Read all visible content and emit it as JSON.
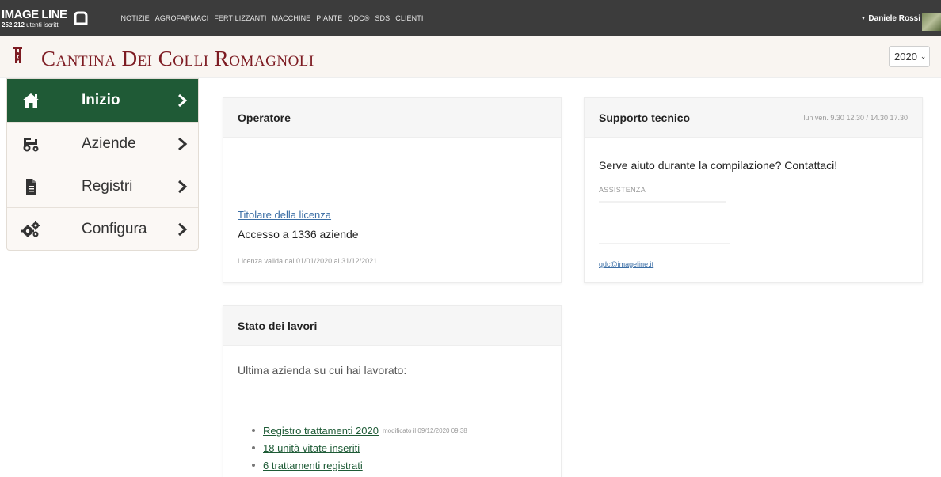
{
  "topbar": {
    "brand_name": "IMAGE LINE",
    "subscribers_count": "252.212",
    "subscribers_label": "utenti iscritti",
    "nav": [
      "NOTIZIE",
      "AGROFARMACI",
      "FERTILIZZANTI",
      "MACCHINE",
      "PIANTE",
      "QDC®",
      "SDS",
      "CLIENTI"
    ],
    "user_name": "Daniele Rossi"
  },
  "header": {
    "title": "Cantina Dei Colli Romagnoli",
    "year_selected": "2020",
    "brand_color": "#7d1b22"
  },
  "sidebar": {
    "active_color": "#1f5a36",
    "items": [
      {
        "label": "Inizio",
        "icon": "home-icon",
        "active": true
      },
      {
        "label": "Aziende",
        "icon": "tractor-icon",
        "active": false
      },
      {
        "label": "Registri",
        "icon": "document-icon",
        "active": false
      },
      {
        "label": "Configura",
        "icon": "gears-icon",
        "active": false
      }
    ]
  },
  "operatore": {
    "title": "Operatore",
    "license_link": "Titolare della licenza",
    "access": "Accesso a 1336 aziende",
    "validity": "Licenza valida dal 01/01/2020 al 31/12/2021"
  },
  "supporto": {
    "title": "Supporto tecnico",
    "hours": "lun ven. 9.30 12.30 / 14.30 17.30",
    "help_text": "Serve aiuto durante la compilazione? Contattaci!",
    "label": "ASSISTENZA",
    "email": "qdc@imageline.it"
  },
  "lavori": {
    "title": "Stato dei lavori",
    "last_company": "Ultima azienda su cui hai lavorato:",
    "items": [
      {
        "text": "Registro trattamenti 2020",
        "note": "modificato il 09/12/2020 09:38"
      },
      {
        "text": "18 unità vitate inseriti",
        "note": ""
      },
      {
        "text": "6 trattamenti registrati",
        "note": ""
      }
    ]
  }
}
